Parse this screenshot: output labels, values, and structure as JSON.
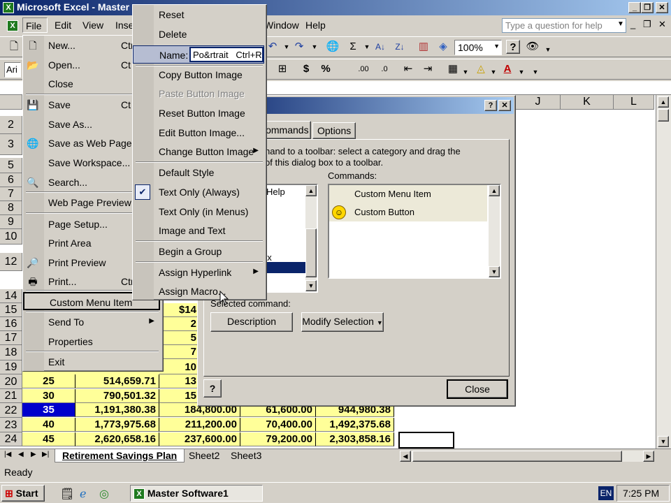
{
  "window": {
    "title": "Microsoft Excel - Master",
    "caption_buttons": [
      "_",
      "❐",
      "✕"
    ],
    "doc_buttons": [
      "_",
      "❐",
      "✕"
    ]
  },
  "menubar": {
    "items": [
      "File",
      "Edit",
      "View",
      "Inse",
      "Window",
      "Help"
    ]
  },
  "help_box": {
    "placeholder": "Type a question for help"
  },
  "toolbar": {
    "zoom": "100%",
    "font_stub": "Ari",
    "sigma": "Σ",
    "currency": "$",
    "percent": "%"
  },
  "grid": {
    "col_headers": [
      "J",
      "K",
      "L"
    ],
    "row_numbers": [
      "2",
      "3",
      "5",
      "6",
      "7",
      "8",
      "9",
      "10",
      "12",
      "14",
      "15",
      "16",
      "17",
      "18",
      "19",
      "20",
      "21",
      "22",
      "23",
      "24"
    ],
    "data_rows": [
      {
        "a": "25",
        "b": "514,659.71",
        "c": "13"
      },
      {
        "a": "30",
        "b": "790,501.32",
        "c": "15"
      },
      {
        "a": "35",
        "b": "1,191,380.38",
        "c": "184,800.00",
        "d": "61,600.00",
        "e": "944,980.38"
      },
      {
        "a": "40",
        "b": "1,773,975.68",
        "c": "211,200.00",
        "d": "70,400.00",
        "e": "1,492,375.68"
      },
      {
        "a": "45",
        "b": "2,620,658.16",
        "c": "237,600.00",
        "d": "79,200.00",
        "e": "2,303,858.16"
      }
    ],
    "partial_c_col": [
      "$14",
      "2",
      "5",
      "7",
      "10"
    ]
  },
  "sheet_tabs": [
    "Retirement Savings Plan",
    "Sheet2",
    "Sheet3"
  ],
  "status": {
    "text": "Ready"
  },
  "taskbar": {
    "start_label": "Start",
    "task_label": "Master Software1",
    "lang": "EN",
    "clock": "7:25 PM"
  },
  "dialog": {
    "tab_commands": "Commands",
    "tab_options": "Options",
    "instruction_line1": "hand to a toolbar: select a category and drag the",
    "instruction_line2": "of this dialog box to a toolbar.",
    "commands_label": "Commands:",
    "categories_partial": [
      "Help",
      "ox"
    ],
    "commands": [
      "Custom Menu Item",
      "Custom Button"
    ],
    "selected_command_label": "Selected command:",
    "description_button": "Description",
    "modify_selection_button": "Modify Selection",
    "close_button": "Close",
    "help_icon": "?",
    "title_help": "?",
    "title_close": "✕"
  },
  "file_menu": {
    "items": [
      {
        "label": "New...",
        "shortcut": "Ctr",
        "icon": "new-icon"
      },
      {
        "label": "Open...",
        "shortcut": "Ct",
        "icon": "open-folder-icon"
      },
      {
        "label": "Close",
        "shortcut": "",
        "icon": ""
      },
      {
        "label": "Save",
        "shortcut": "Ct",
        "icon": "save-icon"
      },
      {
        "label": "Save As...",
        "shortcut": "",
        "icon": ""
      },
      {
        "label": "Save as Web Page...",
        "shortcut": "",
        "icon": "web-page-icon"
      },
      {
        "label": "Save Workspace...",
        "shortcut": "",
        "icon": ""
      },
      {
        "label": "Search...",
        "shortcut": "",
        "icon": "search-icon"
      },
      {
        "label": "Web Page Preview",
        "shortcut": "",
        "icon": ""
      },
      {
        "label": "Page Setup...",
        "shortcut": "",
        "icon": ""
      },
      {
        "label": "Print Area",
        "shortcut": "",
        "icon": ""
      },
      {
        "label": "Print Preview",
        "shortcut": "",
        "icon": "print-preview-icon"
      },
      {
        "label": "Print...",
        "shortcut": "Ctr",
        "icon": "printer-icon"
      },
      {
        "label": "Custom Menu Item",
        "shortcut": "",
        "icon": ""
      },
      {
        "label": "Send To",
        "shortcut": "",
        "icon": ""
      },
      {
        "label": "Properties",
        "shortcut": "",
        "icon": ""
      },
      {
        "label": "Exit",
        "shortcut": "",
        "icon": ""
      }
    ]
  },
  "context_menu": {
    "reset": "Reset",
    "delete": "Delete",
    "name_label": "Name:",
    "name_value": "Po&rtrait   Ctrl+R",
    "copy_image": "Copy Button Image",
    "paste_image": "Paste Button Image",
    "reset_image": "Reset Button Image",
    "edit_image": "Edit Button Image...",
    "change_image": "Change Button Image",
    "default_style": "Default Style",
    "text_only_always": "Text Only (Always)",
    "text_only_menus": "Text Only (in Menus)",
    "image_and_text": "Image and Text",
    "begin_group": "Begin a Group",
    "assign_hyperlink": "Assign Hyperlink",
    "assign_macro": "Assign Macro..."
  },
  "colors": {
    "title_start": "#0a246a",
    "title_end": "#a6caf0",
    "cell_yellow": "#ffff99",
    "selection_blue": "#0000cc"
  }
}
